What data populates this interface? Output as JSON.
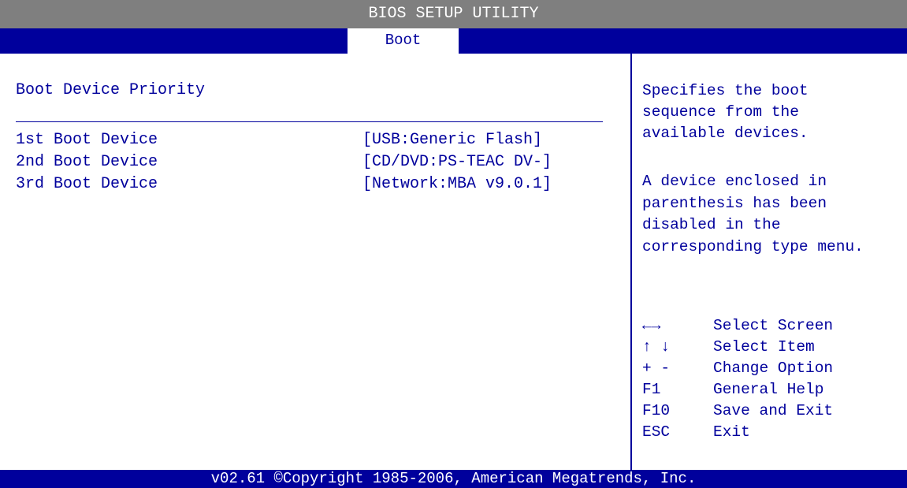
{
  "title_bar": {
    "title": "BIOS SETUP UTILITY"
  },
  "tabs": [
    {
      "label": "Boot",
      "active": true
    }
  ],
  "main": {
    "section_title": "Boot Device Priority",
    "options": [
      {
        "label": "1st Boot Device",
        "value": "[USB:Generic Flash]"
      },
      {
        "label": "2nd Boot Device",
        "value": "[CD/DVD:PS-TEAC DV-]"
      },
      {
        "label": "3rd Boot Device",
        "value": "[Network:MBA v9.0.1]"
      }
    ]
  },
  "help": {
    "lines": [
      "Specifies the boot",
      "sequence from the",
      "available devices.",
      "A device enclosed in",
      "parenthesis has been",
      "disabled in the",
      "corresponding type menu."
    ],
    "keys": [
      {
        "key": "←→",
        "desc": "Select Screen"
      },
      {
        "key": "↑ ↓",
        "desc": "Select Item"
      },
      {
        "key": "+ -",
        "desc": "Change Option"
      },
      {
        "key": "F1",
        "desc": "General Help"
      },
      {
        "key": "F10",
        "desc": "Save and Exit"
      },
      {
        "key": "ESC",
        "desc": "Exit"
      }
    ]
  },
  "footer": {
    "copyright": "v02.61 ©Copyright 1985-2006, American Megatrends, Inc."
  },
  "colors": {
    "bios_blue": "#00009c",
    "title_gray": "#7f7f7f",
    "background": "#ffffff"
  }
}
